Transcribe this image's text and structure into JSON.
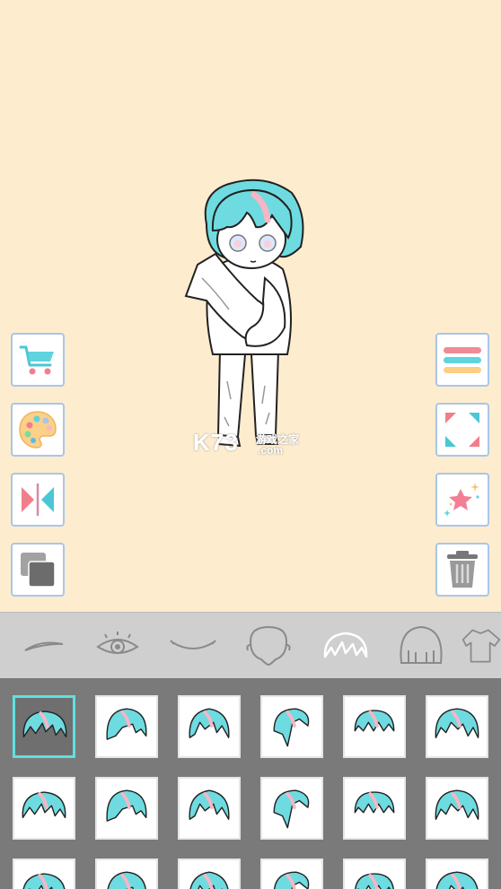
{
  "colors": {
    "stage_bg": "#fdeccd",
    "button_border": "#a9c6e8",
    "hair_cyan": "#6edbe0",
    "hair_pink": "#f6b6c4",
    "tabbar_bg": "#cfcfcf",
    "grid_bg": "#7a7a7a",
    "selected_border": "#5fe0df"
  },
  "watermark": {
    "logo": "K73",
    "site": "游戏之家",
    "domain": ".com"
  },
  "left_buttons": [
    {
      "name": "shop-button",
      "icon": "cart-icon"
    },
    {
      "name": "color-palette-button",
      "icon": "palette-icon"
    },
    {
      "name": "flip-button",
      "icon": "mirror-flip-icon"
    },
    {
      "name": "layer-button",
      "icon": "layers-icon"
    }
  ],
  "right_buttons": [
    {
      "name": "menu-button",
      "icon": "menu-icon"
    },
    {
      "name": "fullscreen-button",
      "icon": "expand-icon"
    },
    {
      "name": "effects-button",
      "icon": "sparkle-star-icon"
    },
    {
      "name": "delete-button",
      "icon": "trash-icon"
    }
  ],
  "tabs": [
    {
      "name": "tab-eyebrows",
      "icon": "eyebrow-icon",
      "selected": false
    },
    {
      "name": "tab-eyes",
      "icon": "eye-icon",
      "selected": false
    },
    {
      "name": "tab-mouth",
      "icon": "mouth-icon",
      "selected": false
    },
    {
      "name": "tab-face",
      "icon": "face-outline-icon",
      "selected": false
    },
    {
      "name": "tab-front-hair",
      "icon": "front-hair-icon",
      "selected": true
    },
    {
      "name": "tab-back-hair",
      "icon": "back-hair-icon",
      "selected": false
    },
    {
      "name": "tab-clothes",
      "icon": "shirt-icon",
      "selected": false
    }
  ],
  "hair_items": [
    {
      "style": 1,
      "selected": true
    },
    {
      "style": 2,
      "selected": false
    },
    {
      "style": 3,
      "selected": false
    },
    {
      "style": 4,
      "selected": false
    },
    {
      "style": 5,
      "selected": false
    },
    {
      "style": 6,
      "selected": false
    },
    {
      "style": 7,
      "selected": false
    },
    {
      "style": 8,
      "selected": false
    },
    {
      "style": 9,
      "selected": false
    },
    {
      "style": 10,
      "selected": false
    },
    {
      "style": 11,
      "selected": false
    },
    {
      "style": 12,
      "selected": false
    },
    {
      "style": 13,
      "selected": false
    },
    {
      "style": 14,
      "selected": false
    },
    {
      "style": 15,
      "selected": false
    },
    {
      "style": 16,
      "selected": false
    },
    {
      "style": 17,
      "selected": false
    },
    {
      "style": 18,
      "selected": false
    }
  ]
}
